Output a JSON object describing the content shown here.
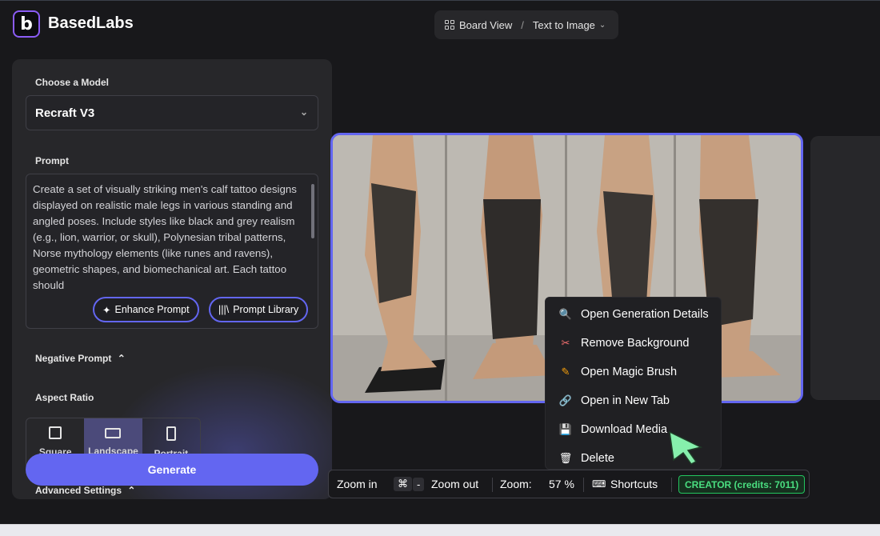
{
  "header": {
    "brand_name": "BasedLabs",
    "logo_letter": "b",
    "breadcrumb": {
      "view": "Board View",
      "separator": "/",
      "mode": "Text to Image"
    }
  },
  "sidebar": {
    "model_label": "Choose a Model",
    "model_value": "Recraft V3",
    "prompt_label": "Prompt",
    "prompt_text": "Create a set of visually striking men's calf tattoo designs displayed on realistic male legs in various standing and angled poses. Include styles like black and grey realism (e.g., lion, warrior, or skull), Polynesian tribal patterns, Norse mythology elements (like runes and ravens), geometric shapes, and biomechanical art. Each tattoo should",
    "enhance_button": "Enhance Prompt",
    "library_button": "Prompt Library",
    "negative_prompt_label": "Negative Prompt",
    "aspect_label": "Aspect Ratio",
    "aspect_options": [
      "Square",
      "Landscape",
      "Portrait"
    ],
    "aspect_selected": "Landscape",
    "generate_button": "Generate",
    "advanced_label": "Advanced Settings"
  },
  "context_menu": {
    "items": [
      {
        "label": "Open Generation Details",
        "icon": "magnifier-icon"
      },
      {
        "label": "Remove Background",
        "icon": "scissors-icon"
      },
      {
        "label": "Open Magic Brush",
        "icon": "brush-icon"
      },
      {
        "label": "Open in New Tab",
        "icon": "link-icon"
      },
      {
        "label": "Download Media",
        "icon": "floppy-disk-icon"
      },
      {
        "label": "Delete",
        "icon": "trash-icon"
      }
    ]
  },
  "bottombar": {
    "zoom_in": "Zoom in",
    "cmd_key": "⌘",
    "minus_key": "-",
    "zoom_out": "Zoom out",
    "zoom_label": "Zoom:",
    "zoom_value": "57 %",
    "shortcuts": "Shortcuts",
    "credits": "CREATOR (credits: 7011)"
  },
  "colors": {
    "accent": "#6366f1",
    "panel": "#27272a",
    "background": "#18181b",
    "credits_green": "#4ade80",
    "cursor_green": "#86efac"
  }
}
